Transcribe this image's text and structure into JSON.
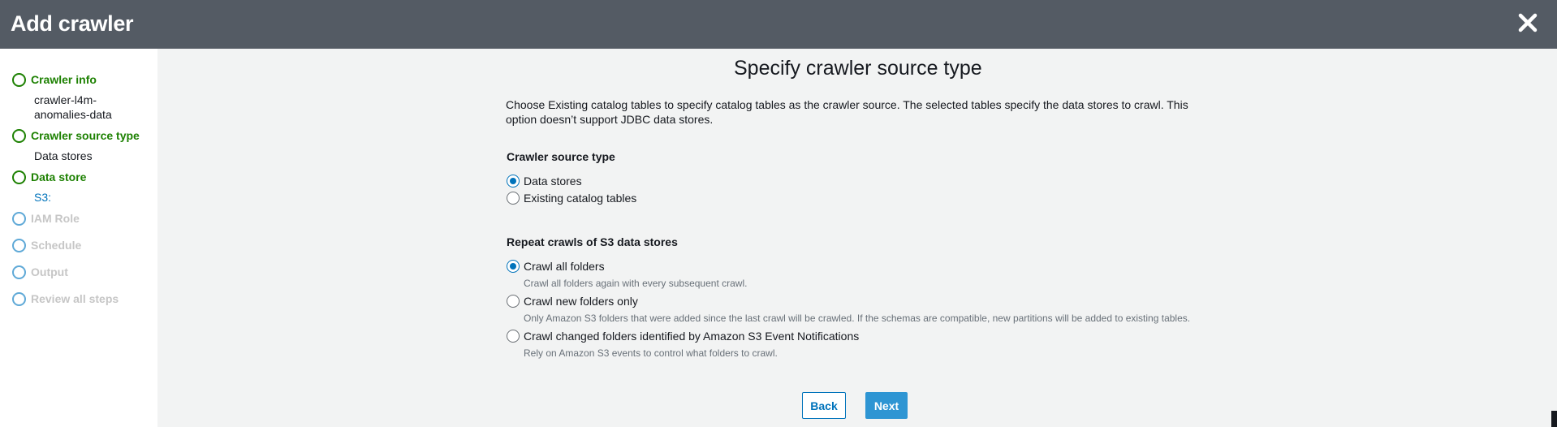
{
  "header": {
    "title": "Add crawler",
    "close_icon": "close-icon"
  },
  "sidebar": {
    "steps": [
      {
        "label": "Crawler info",
        "sub": "crawler-l4m-anomalies-data",
        "state": "done"
      },
      {
        "label": "Crawler source type",
        "sub": "Data stores",
        "state": "done"
      },
      {
        "label": "Data store",
        "sub": "S3:",
        "state": "done"
      },
      {
        "label": "IAM Role",
        "state": "pending"
      },
      {
        "label": "Schedule",
        "state": "pending"
      },
      {
        "label": "Output",
        "state": "pending"
      },
      {
        "label": "Review all steps",
        "state": "pending"
      }
    ]
  },
  "main": {
    "title": "Specify crawler source type",
    "description": "Choose Existing catalog tables to specify catalog tables as the crawler source. The selected tables specify the data stores to crawl. This option doesn’t support JDBC data stores.",
    "source_type": {
      "label": "Crawler source type",
      "options": [
        {
          "label": "Data stores",
          "checked": true
        },
        {
          "label": "Existing catalog tables",
          "checked": false
        }
      ]
    },
    "repeat_crawls": {
      "label": "Repeat crawls of S3 data stores",
      "options": [
        {
          "label": "Crawl all folders",
          "help": "Crawl all folders again with every subsequent crawl.",
          "checked": true
        },
        {
          "label": "Crawl new folders only",
          "help": "Only Amazon S3 folders that were added since the last crawl will be crawled. If the schemas are compatible, new partitions will be added to existing tables.",
          "checked": false
        },
        {
          "label": "Crawl changed folders identified by Amazon S3 Event Notifications",
          "help": "Rely on Amazon S3 events to control what folders to crawl.",
          "checked": false
        }
      ]
    },
    "buttons": {
      "back": "Back",
      "next": "Next"
    }
  },
  "colors": {
    "header_bg": "#545b64",
    "step_done": "#1d8102",
    "step_pending": "#5fa9d7",
    "accent": "#0073bb",
    "primary_button": "#2e95d3"
  }
}
